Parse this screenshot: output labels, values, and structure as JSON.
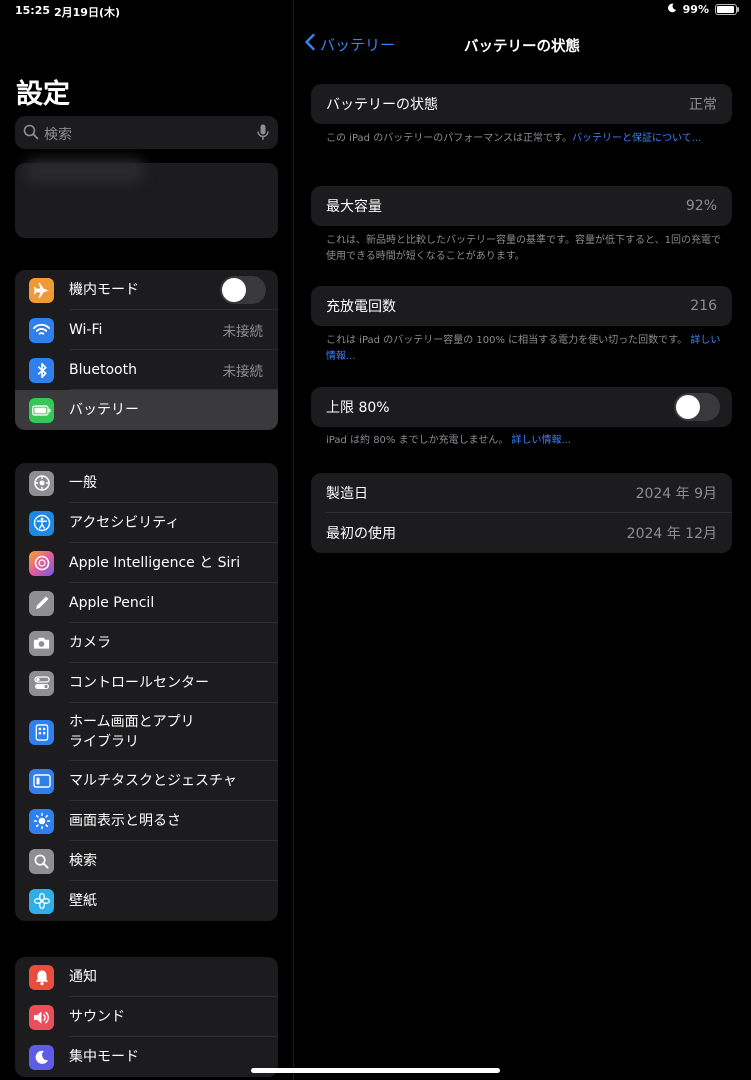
{
  "status": {
    "time": "15:25",
    "date": "2月19日(木)",
    "battery": "99%",
    "battery_level": 0.99
  },
  "sidebar": {
    "title": "設定",
    "search_placeholder": "検索",
    "group1": [
      {
        "label": "機内モード",
        "icon": "airplane-icon",
        "color": "#F09A37",
        "toggle": false
      },
      {
        "label": "Wi-Fi",
        "icon": "wifi-icon",
        "color": "#2F80ED",
        "value": "未接続"
      },
      {
        "label": "Bluetooth",
        "icon": "bluetooth-icon",
        "color": "#2F80ED",
        "value": "未接続"
      },
      {
        "label": "バッテリー",
        "icon": "battery-icon",
        "color": "#34C759",
        "selected": true
      }
    ],
    "group2": [
      {
        "label": "一般",
        "icon": "gear-icon",
        "color": "#8E8E93"
      },
      {
        "label": "アクセシビリティ",
        "icon": "accessibility-icon",
        "color": "#1E88E5"
      },
      {
        "label": "Apple Intelligence と Siri",
        "icon": "apple-intelligence-icon",
        "color": "#E45C9C"
      },
      {
        "label": "Apple Pencil",
        "icon": "pencil-icon",
        "color": "#8E8E93"
      },
      {
        "label": "カメラ",
        "icon": "camera-icon",
        "color": "#8E8E93"
      },
      {
        "label": "コントロールセンター",
        "icon": "control-center-icon",
        "color": "#8E8E93"
      },
      {
        "label": "ホーム画面とアプリ\nライブラリ",
        "icon": "home-screen-icon",
        "color": "#2F80ED"
      },
      {
        "label": "マルチタスクとジェスチャ",
        "icon": "multitask-icon",
        "color": "#2F80ED"
      },
      {
        "label": "画面表示と明るさ",
        "icon": "brightness-icon",
        "color": "#2F80ED"
      },
      {
        "label": "検索",
        "icon": "search-icon",
        "color": "#8E8E93"
      },
      {
        "label": "壁紙",
        "icon": "wallpaper-icon",
        "color": "#30AEE8"
      }
    ],
    "group3": [
      {
        "label": "通知",
        "icon": "bell-icon",
        "color": "#EB4D3D"
      },
      {
        "label": "サウンド",
        "icon": "speaker-icon",
        "color": "#EB4D5A"
      },
      {
        "label": "集中モード",
        "icon": "moon-icon",
        "color": "#5E5CE6"
      }
    ]
  },
  "main": {
    "back_label": "バッテリー",
    "title": "バッテリーの状態",
    "health": {
      "label": "バッテリーの状態",
      "value": "正常"
    },
    "health_note": "この iPad のバッテリーのパフォーマンスは正常です。",
    "health_link": "バッテリーと保証について...",
    "capacity": {
      "label": "最大容量",
      "value": "92%"
    },
    "capacity_note": "これは、新品時と比較したバッテリー容量の基準です。容量が低下すると、1回の充電で使用できる時間が短くなることがあります。",
    "cycles": {
      "label": "充放電回数",
      "value": "216"
    },
    "cycles_note": "これは iPad のバッテリー容量の 100% に相当する電力を使い切った回数です。",
    "cycles_link": "詳しい情報...",
    "limit": {
      "label": "上限 80%",
      "toggle": false
    },
    "limit_note": "iPad は約 80% までしか充電しません。",
    "limit_link": "詳しい情報...",
    "manufactured": {
      "label": "製造日",
      "value": "2024 年 9月"
    },
    "first_use": {
      "label": "最初の使用",
      "value": "2024 年 12月"
    }
  }
}
